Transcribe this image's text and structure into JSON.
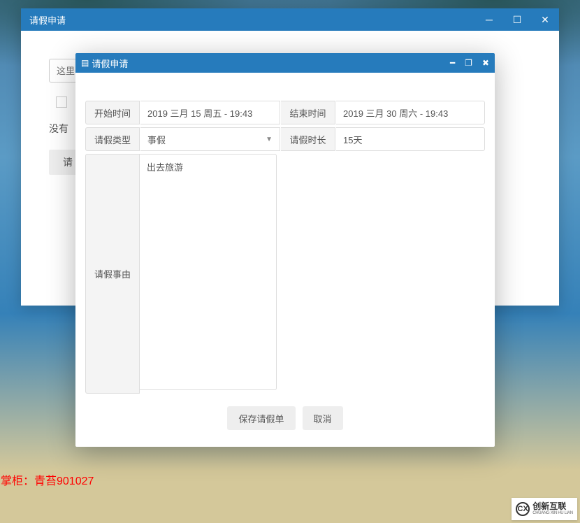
{
  "outerWindow": {
    "title": "请假申请",
    "inputPlaceholder": "这里",
    "noResultText": "没有",
    "buttonPrefix": "请"
  },
  "dialog": {
    "title": "请假申请",
    "fields": {
      "startTimeLabel": "开始时间",
      "startTimeValue": "2019 三月 15 周五 - 19:43",
      "endTimeLabel": "结束时间",
      "endTimeValue": "2019 三月 30 周六 - 19:43",
      "leaveTypeLabel": "请假类型",
      "leaveTypeValue": "事假",
      "durationLabel": "请假时长",
      "durationValue": "15天",
      "reasonLabel": "请假事由",
      "reasonValue": "出去旅游"
    },
    "buttons": {
      "save": "保存请假单",
      "cancel": "取消"
    }
  },
  "watermark": "掌柜：青苔901027",
  "brand": {
    "cn": "创新互联",
    "en": "CHUANG XIN HU LIAN",
    "mark": "CX"
  }
}
